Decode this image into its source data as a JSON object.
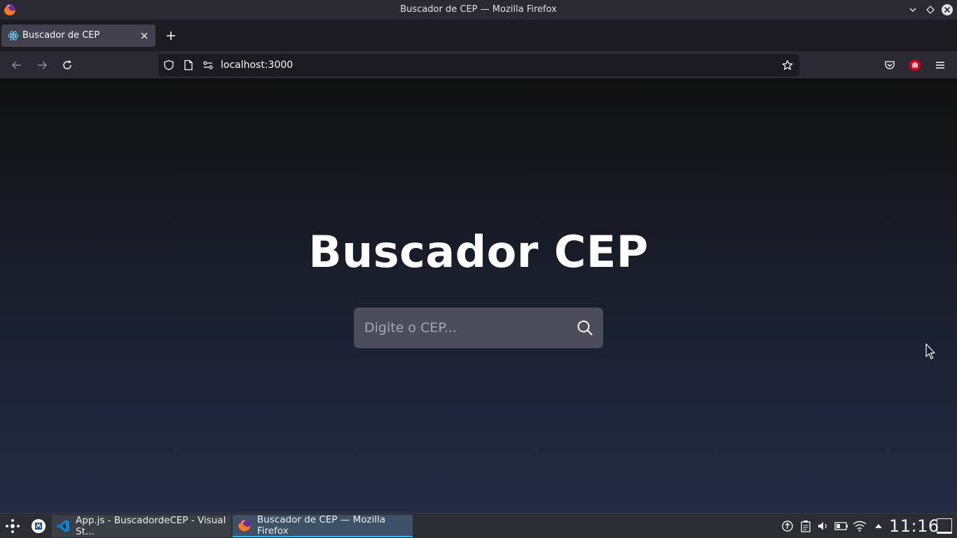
{
  "window": {
    "title": "Buscador de CEP — Mozilla Firefox"
  },
  "tabs": [
    {
      "label": "Buscador de CEP",
      "favicon": "react-icon",
      "active": true
    }
  ],
  "navbar": {
    "url": "localhost:3000"
  },
  "page": {
    "title": "Buscador CEP",
    "search": {
      "placeholder": "Digite o CEP...",
      "value": ""
    }
  },
  "taskbar": {
    "tasks": [
      {
        "label": "App.js - BuscadordeCEP - Visual St...",
        "icon": "vscode-icon"
      },
      {
        "label": "Buscador de CEP — Mozilla Firefox",
        "icon": "firefox-icon",
        "active": true
      }
    ],
    "clock": "11:16"
  },
  "colors": {
    "accent": "#3daee9",
    "search_bg": "#4b4c5c",
    "page_bg_top": "#111111",
    "page_bg_bottom": "#222a44"
  }
}
